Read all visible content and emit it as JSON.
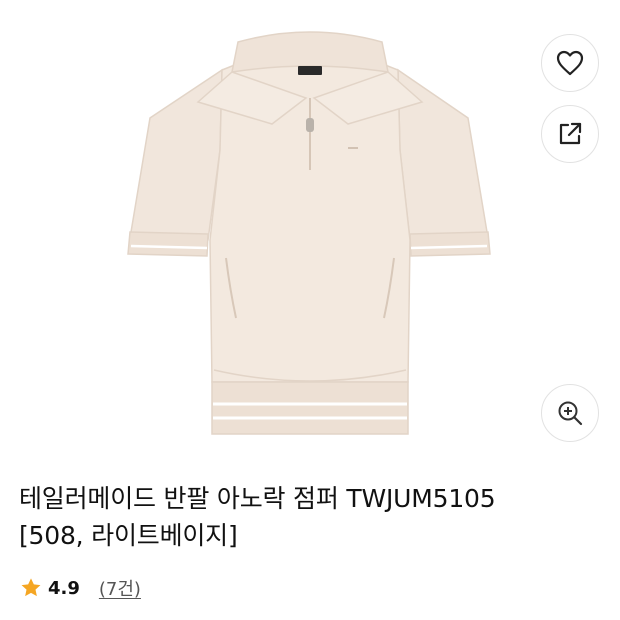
{
  "product": {
    "title_line1": "테일러메이드 반팔 아노락 점퍼 TWJUM5105",
    "title_line2": "[508, 라이트베이지]",
    "image": {
      "alt": "beige short-sleeve anorak jacket",
      "fabric_color": "#f1e6dc",
      "shadow_color": "#e2d4c7",
      "stripe_color": "#ffffff"
    }
  },
  "actions": {
    "wishlist_icon": "heart-icon",
    "share_icon": "share-icon",
    "zoom_icon": "zoom-in-icon"
  },
  "rating": {
    "icon": "star-icon",
    "star_color": "#f5a623",
    "value": "4.9",
    "review_count": "(7건)"
  }
}
